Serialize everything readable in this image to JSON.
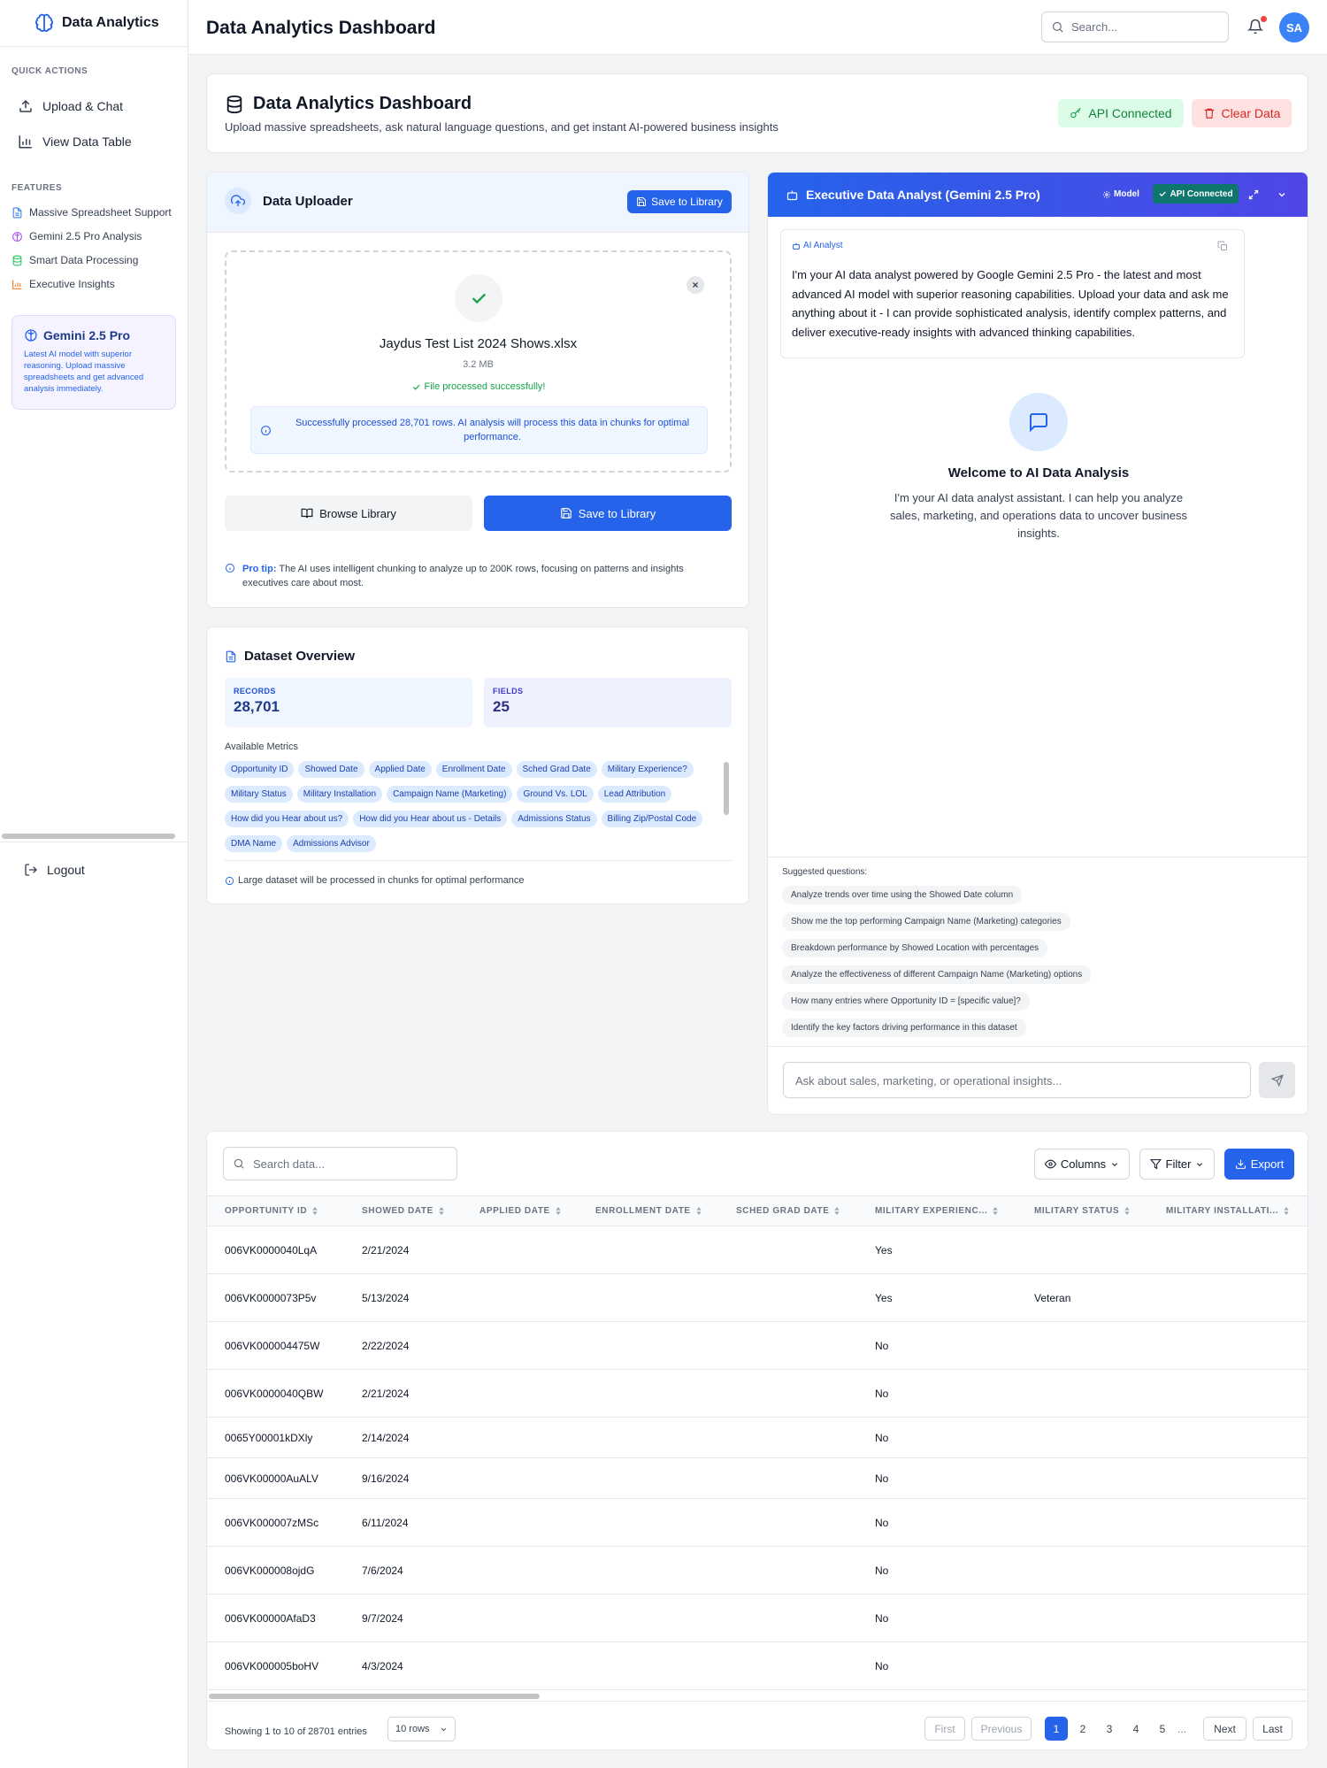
{
  "sidebar": {
    "brand": "Data Analytics",
    "quick_actions_title": "QUICK ACTIONS",
    "quick_actions": [
      {
        "label": "Upload & Chat",
        "icon": "upload-icon"
      },
      {
        "label": "View Data Table",
        "icon": "bar-chart-icon"
      }
    ],
    "features_title": "FEATURES",
    "features": [
      {
        "label": "Massive Spreadsheet Support",
        "icon": "file-text-icon",
        "color": "#3b82f6"
      },
      {
        "label": "Gemini 2.5 Pro Analysis",
        "icon": "brain-icon",
        "color": "#a855f7"
      },
      {
        "label": "Smart Data Processing",
        "icon": "database-icon",
        "color": "#22c55e"
      },
      {
        "label": "Executive Insights",
        "icon": "bar-chart-icon",
        "color": "#f97316"
      }
    ],
    "promo": {
      "title": "Gemini 2.5 Pro",
      "text": "Latest AI model with superior reasoning. Upload massive spreadsheets and get advanced analysis immediately."
    },
    "logout": "Logout"
  },
  "topbar": {
    "title": "Data Analytics Dashboard",
    "search_placeholder": "Search...",
    "avatar": "SA"
  },
  "header": {
    "title": "Data Analytics Dashboard",
    "subtitle": "Upload massive spreadsheets, ask natural language questions, and get instant AI-powered business insights",
    "api_label": "API Connected",
    "clear_label": "Clear Data"
  },
  "uploader": {
    "title": "Data Uploader",
    "save_small": "Save to Library",
    "file_name": "Jaydus Test List 2024 Shows.xlsx",
    "file_size": "3.2 MB",
    "status": "File processed successfully!",
    "info": "Successfully processed 28,701 rows. AI analysis will process this data in chunks for optimal performance.",
    "browse": "Browse Library",
    "save": "Save to Library",
    "tip_label": "Pro tip:",
    "tip_text": "The AI uses intelligent chunking to analyze up to 200K rows, focusing on patterns and insights executives care about most."
  },
  "overview": {
    "title": "Dataset Overview",
    "records_label": "RECORDS",
    "records": "28,701",
    "fields_label": "FIELDS",
    "fields": "25",
    "metrics_title": "Available Metrics",
    "metrics": [
      "Opportunity ID",
      "Showed Date",
      "Applied Date",
      "Enrollment Date",
      "Sched Grad Date",
      "Military Experience?",
      "Military Status",
      "Military Installation",
      "Campaign Name (Marketing)",
      "Ground Vs. LOL",
      "Lead Attribution",
      "How did you Hear about us?",
      "How did you Hear about us - Details",
      "Admissions Status",
      "Billing Zip/Postal Code",
      "DMA Name",
      "Admissions Advisor"
    ],
    "note": "Large dataset will be processed in chunks for optimal performance"
  },
  "chat": {
    "title": "Executive Data Analyst (Gemini 2.5 Pro)",
    "model": "Model",
    "api": "API Connected",
    "bubble_label": "AI Analyst",
    "bubble_text": "I'm your AI data analyst powered by Google Gemini 2.5 Pro - the latest and most advanced AI model with superior reasoning capabilities. Upload your data and ask me anything about it - I can provide sophisticated analysis, identify complex patterns, and deliver executive-ready insights with advanced thinking capabilities.",
    "welcome_title": "Welcome to AI Data Analysis",
    "welcome_text": "I'm your AI data analyst assistant. I can help you analyze sales, marketing, and operations data to uncover business insights.",
    "suggested_label": "Suggested questions:",
    "suggestions": [
      "Analyze trends over time using the Showed Date column",
      "Show me the top performing Campaign Name (Marketing) categories",
      "Breakdown performance by Showed Location with percentages",
      "Analyze the effectiveness of different Campaign Name (Marketing) options",
      "How many entries where Opportunity ID = [specific value]?",
      "Identify the key factors driving performance in this dataset"
    ],
    "input_placeholder": "Ask about sales, marketing, or operational insights..."
  },
  "table": {
    "search_placeholder": "Search data...",
    "columns_btn": "Columns",
    "filter_btn": "Filter",
    "export_btn": "Export",
    "headers": [
      "OPPORTUNITY ID",
      "SHOWED DATE",
      "APPLIED DATE",
      "ENROLLMENT DATE",
      "SCHED GRAD DATE",
      "MILITARY EXPERIENC...",
      "MILITARY STATUS",
      "MILITARY INSTALLATI..."
    ],
    "rows": [
      [
        "006VK0000040LqA",
        "2/21/2024",
        "",
        "",
        "",
        "Yes",
        "",
        ""
      ],
      [
        "006VK0000073P5v",
        "5/13/2024",
        "",
        "",
        "",
        "Yes",
        "Veteran",
        ""
      ],
      [
        "006VK000004475W",
        "2/22/2024",
        "",
        "",
        "",
        "No",
        "",
        ""
      ],
      [
        "006VK0000040QBW",
        "2/21/2024",
        "",
        "",
        "",
        "No",
        "",
        ""
      ],
      [
        "0065Y00001kDXly",
        "2/14/2024",
        "",
        "",
        "",
        "No",
        "",
        ""
      ],
      [
        "006VK00000AuALV",
        "9/16/2024",
        "",
        "",
        "",
        "No",
        "",
        ""
      ],
      [
        "006VK000007zMSc",
        "6/11/2024",
        "",
        "",
        "",
        "No",
        "",
        ""
      ],
      [
        "006VK000008ojdG",
        "7/6/2024",
        "",
        "",
        "",
        "No",
        "",
        ""
      ],
      [
        "006VK00000AfaD3",
        "9/7/2024",
        "",
        "",
        "",
        "No",
        "",
        ""
      ],
      [
        "006VK000005boHV",
        "4/3/2024",
        "",
        "",
        "",
        "No",
        "",
        ""
      ]
    ],
    "showing": "Showing 1 to 10 of 28701 entries",
    "rows_select": "10 rows",
    "pagination": {
      "first": "First",
      "previous": "Previous",
      "pages": [
        "1",
        "2",
        "3",
        "4",
        "5"
      ],
      "ellipsis": "...",
      "next": "Next",
      "last": "Last"
    }
  },
  "colors": {
    "primary": "#2563eb",
    "success": "#16a34a",
    "danger": "#dc2626",
    "chat_header": "#4f46e5"
  }
}
